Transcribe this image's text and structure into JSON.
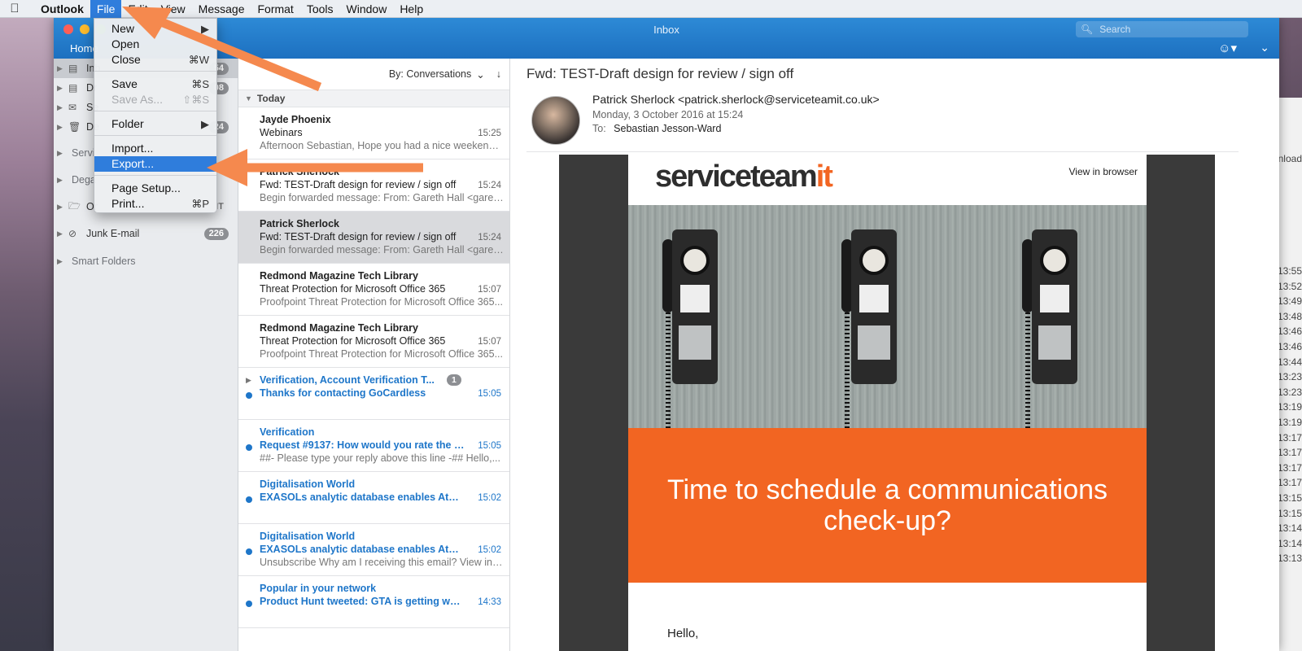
{
  "menubar": {
    "apple": "",
    "app_name": "Outlook",
    "items": [
      "File",
      "Edit",
      "View",
      "Message",
      "Format",
      "Tools",
      "Window",
      "Help"
    ]
  },
  "window": {
    "title": "Inbox",
    "search_placeholder": "Search",
    "ribbon_tab": "Home"
  },
  "file_menu": {
    "items": [
      {
        "label": "New",
        "shortcut": "▶"
      },
      {
        "label": "Open",
        "shortcut": ""
      },
      {
        "label": "Close",
        "shortcut": "⌘W"
      },
      {
        "label": "Save",
        "shortcut": "⌘S"
      },
      {
        "label": "Save As...",
        "shortcut": "⇧⌘S"
      },
      {
        "label": "Folder",
        "shortcut": "▶"
      },
      {
        "label": "Import...",
        "shortcut": ""
      },
      {
        "label": "Export...",
        "shortcut": ""
      },
      {
        "label": "Page Setup...",
        "shortcut": ""
      },
      {
        "label": "Print...",
        "shortcut": "⌘P"
      }
    ]
  },
  "sidebar": {
    "folders": [
      {
        "label": "Inb",
        "count": "54"
      },
      {
        "label": "Dr",
        "count": "08"
      },
      {
        "label": "Se",
        "count": ""
      },
      {
        "label": "De",
        "count": "24"
      },
      {
        "label": "Servi",
        "count": ""
      },
      {
        "label": "Dega",
        "count": ""
      },
      {
        "label": "Or",
        "count": "IT"
      },
      {
        "label": "Junk E-mail",
        "count": "226"
      },
      {
        "label": "Smart Folders",
        "count": ""
      }
    ]
  },
  "msglist": {
    "sort_label": "By: Conversations",
    "sort_chevron": "⌄",
    "sort_dir": "↓",
    "group": "Today",
    "messages": [
      {
        "from": "Jayde Phoenix",
        "subject": "Webinars",
        "preview": "Afternoon Sebastian, Hope you had a nice weekend. I...",
        "time": "15:25"
      },
      {
        "from": "Patrick Sherlock",
        "subject": "Fwd: TEST-Draft design for review / sign off",
        "preview": "Begin forwarded message: From: Gareth Hall <gareth...",
        "time": "15:24"
      },
      {
        "from": "Patrick Sherlock",
        "subject": "Fwd: TEST-Draft design for review / sign off",
        "preview": "Begin forwarded message: From: Gareth Hall <gareth...",
        "time": "15:24"
      },
      {
        "from": "Redmond Magazine Tech Library",
        "subject": "Threat Protection for Microsoft Office 365",
        "preview": "Proofpoint Threat Protection for Microsoft Office 365...",
        "time": "15:07"
      },
      {
        "from": "Redmond Magazine Tech Library",
        "subject": "Threat Protection for Microsoft Office 365",
        "preview": "Proofpoint Threat Protection for Microsoft Office 365...",
        "time": "15:07"
      },
      {
        "from": "Verification, Account Verification T...",
        "subject": "Thanks for contacting GoCardless",
        "preview": "",
        "time": "15:05",
        "badge": "1"
      },
      {
        "from": "Verification",
        "subject": "Request #9137: How would you rate the sup...",
        "preview": "##- Please type your reply above this line -## Hello,...",
        "time": "15:05"
      },
      {
        "from": "Digitalisation World",
        "subject": "EXASOLs analytic database enables Atheon...",
        "preview": "",
        "time": "15:02"
      },
      {
        "from": "Digitalisation World",
        "subject": "EXASOLs analytic database enables Atheon...",
        "preview": "Unsubscribe Why am I receiving this email? View in y...",
        "time": "15:02"
      },
      {
        "from": "Popular in your network",
        "subject": "Product Hunt tweeted: GTA is getting way to...",
        "preview": "",
        "time": "14:33"
      }
    ]
  },
  "reading": {
    "subject": "Fwd: TEST-Draft design for review / sign off",
    "from": "Patrick Sherlock <patrick.sherlock@serviceteamit.co.uk>",
    "date": "Monday, 3 October 2016 at 15:24",
    "to_label": "To:",
    "to": "Sebastian Jesson-Ward",
    "email": {
      "logo_main": "serviceteam",
      "logo_accent": "it",
      "view_in_browser": "View in browser",
      "headline": "Time to schedule a communications check-up?",
      "greeting": "Hello,"
    }
  },
  "background_window": {
    "label": "nload",
    "times": [
      "13:55",
      "13:52",
      "13:49",
      "13:48",
      "13:46",
      "13:46",
      "13:44",
      "13:23",
      "13:23",
      "13:19",
      "13:19",
      "13:17",
      "13:17",
      "13:17",
      "13:17",
      "13:15",
      "13:15",
      "13:14",
      "13:14",
      "13:13"
    ]
  },
  "colors": {
    "accent": "#1e76c9",
    "brand_orange": "#f26522",
    "annotation_arrow": "#f5894e"
  }
}
